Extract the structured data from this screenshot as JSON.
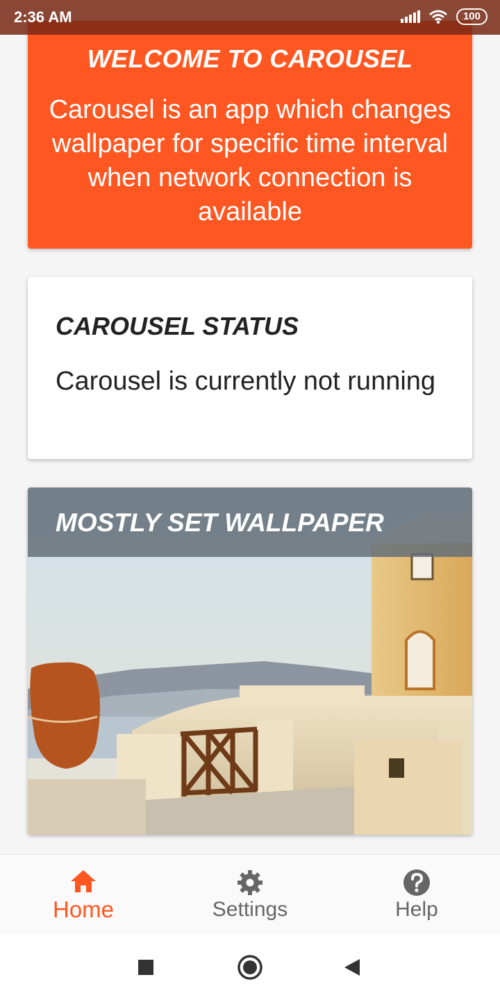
{
  "status_bar": {
    "time": "2:36 AM",
    "battery": "100"
  },
  "welcome_card": {
    "title": "WELCOME TO CAROUSEL",
    "body": "Carousel is an app which changes wallpaper for specific time interval when network connection is available"
  },
  "status_card": {
    "title": "CAROUSEL STATUS",
    "body": "Carousel is currently not running"
  },
  "wallpaper_card": {
    "title": "MOSTLY SET WALLPAPER"
  },
  "bottom_nav": {
    "items": [
      {
        "label": "Home",
        "icon": "home-icon",
        "active": true
      },
      {
        "label": "Settings",
        "icon": "gear-icon",
        "active": false
      },
      {
        "label": "Help",
        "icon": "help-icon",
        "active": false
      }
    ]
  },
  "colors": {
    "accent": "#ff5722",
    "card_bg": "#ffffff",
    "inactive": "#666666"
  }
}
